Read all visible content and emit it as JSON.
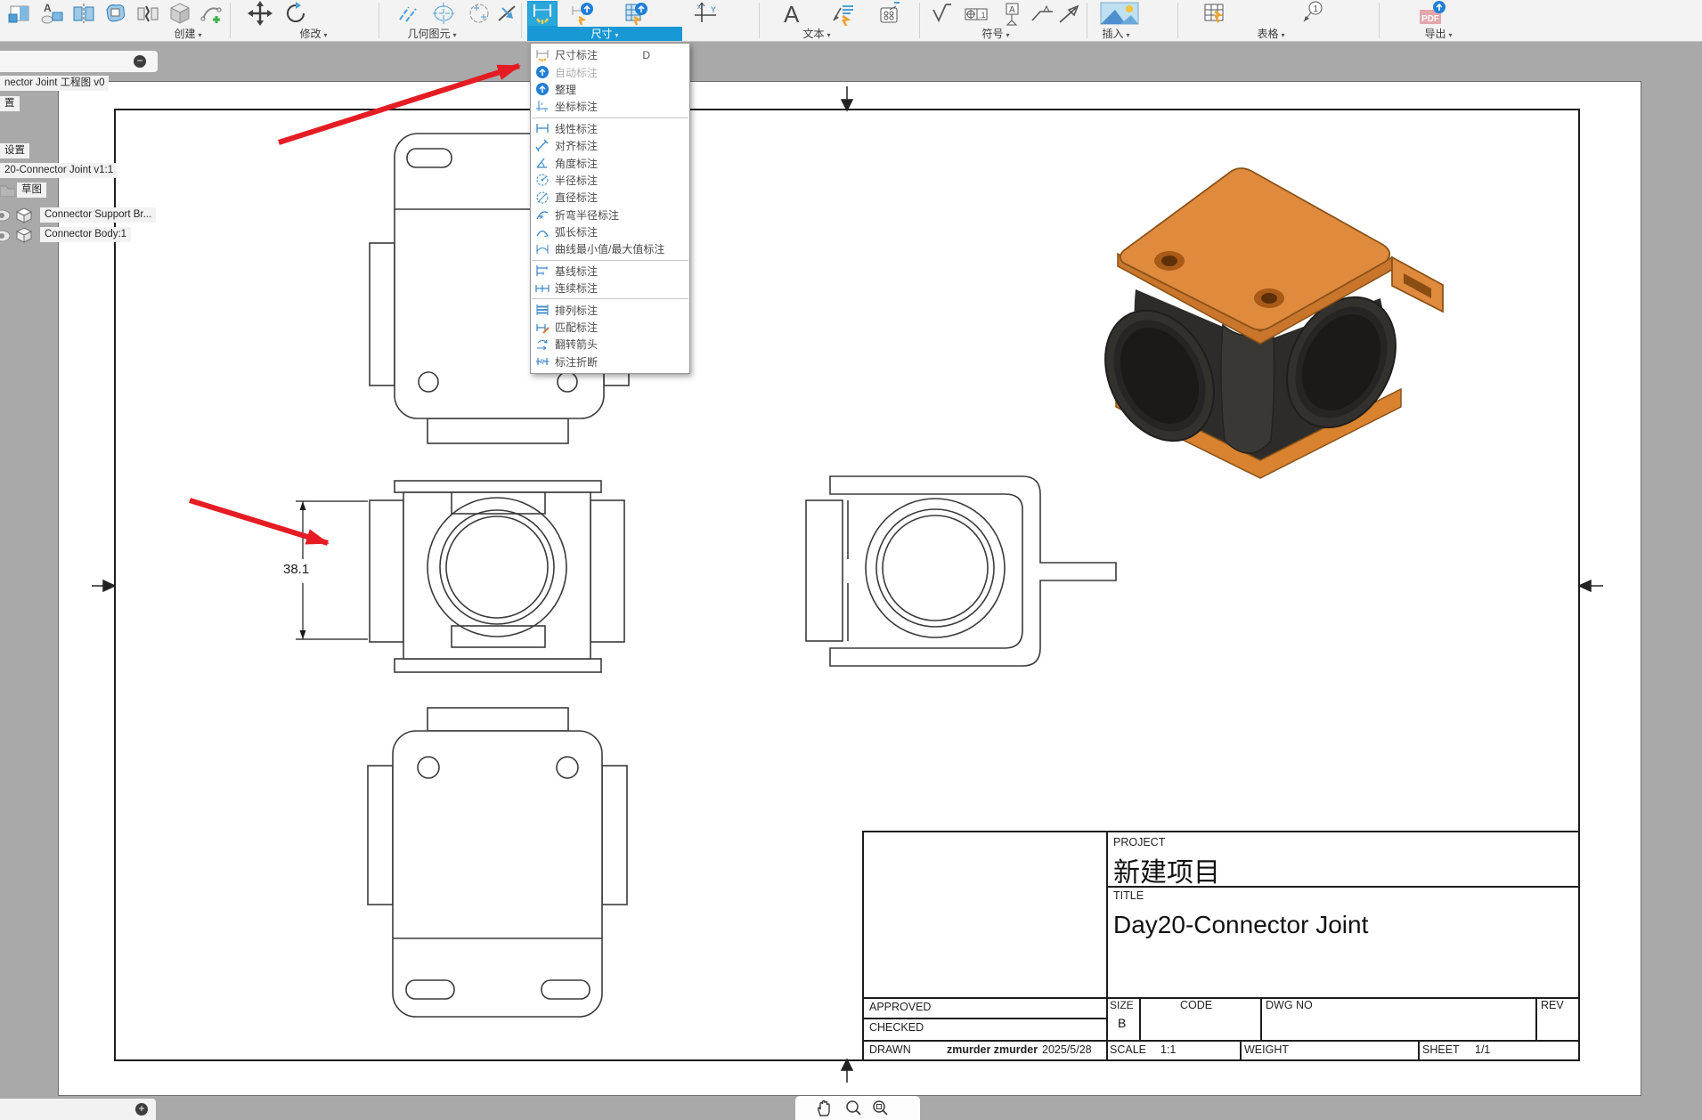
{
  "ui": {
    "caret": "▾",
    "minus_glyph": "−",
    "plus_glyph": "+"
  },
  "toolbar": {
    "groups": [
      {
        "label": "创建"
      },
      {
        "label": "修改"
      },
      {
        "label": "几何图元"
      },
      {
        "label": "尺寸",
        "highlighted": true
      },
      {
        "label": "文本"
      },
      {
        "label": "符号"
      },
      {
        "label": "插入"
      },
      {
        "label": "表格"
      },
      {
        "label": "导出"
      }
    ]
  },
  "menu": {
    "items": [
      {
        "label": "尺寸标注",
        "shortcut": "D"
      },
      {
        "label": "自动标注",
        "disabled": true
      },
      {
        "label": "整理"
      },
      {
        "label": "坐标标注"
      },
      {
        "label": "线性标注"
      },
      {
        "label": "对齐标注"
      },
      {
        "label": "角度标注"
      },
      {
        "label": "半径标注"
      },
      {
        "label": "直径标注"
      },
      {
        "label": "折弯半径标注"
      },
      {
        "label": "弧长标注"
      },
      {
        "label": "曲线最小值/最大值标注"
      },
      {
        "label": "基线标注"
      },
      {
        "label": "连续标注"
      },
      {
        "label": "排列标注"
      },
      {
        "label": "匹配标注"
      },
      {
        "label": "翻转箭头"
      },
      {
        "label": "标注折断"
      }
    ]
  },
  "browser": {
    "document_label": "nector Joint 工程图 v0",
    "clipped_label": "置",
    "settings_label": "设置",
    "model_label": "20-Connector Joint v1:1",
    "sketch_label": "草图",
    "bodies": [
      {
        "label": "Connector Support Br..."
      },
      {
        "label": "Connector Body:1"
      }
    ]
  },
  "drawing": {
    "dimension_value": "38.1"
  },
  "title_block": {
    "project_label": "PROJECT",
    "project_value": "新建项目",
    "title_label": "TITLE",
    "title_value": "Day20-Connector Joint",
    "approved_label": "APPROVED",
    "checked_label": "CHECKED",
    "drawn_label": "DRAWN",
    "drawn_by": "zmurder zmurder",
    "drawn_date": "2025/5/28",
    "size_label": "SIZE",
    "size_value": "B",
    "code_label": "CODE",
    "dwg_no_label": "DWG NO",
    "rev_label": "REV",
    "scale_label": "SCALE",
    "scale_value": "1:1",
    "weight_label": "WEIGHT",
    "sheet_label": "SHEET",
    "sheet_value": "1/1"
  },
  "colors": {
    "accent_blue": "#1899d5",
    "arrow_red": "#e51c23",
    "part_orange": "#e08a3e",
    "part_dark": "#2e2c2a"
  }
}
